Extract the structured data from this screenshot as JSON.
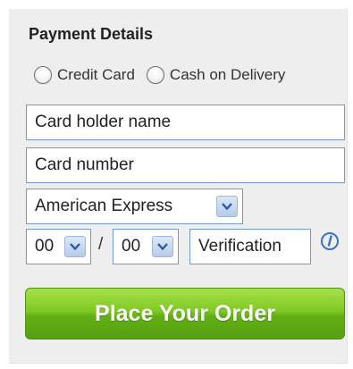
{
  "form": {
    "title": "Payment Details",
    "payment_options": [
      {
        "label": "Credit Card"
      },
      {
        "label": "Cash on Delivery"
      }
    ],
    "card_holder_name": {
      "value": "Card holder name"
    },
    "card_number": {
      "value": "Card number"
    },
    "card_type": {
      "selected": "American Express"
    },
    "expiry_month": {
      "selected": "00"
    },
    "expiry_separator": "/",
    "expiry_year": {
      "selected": "00"
    },
    "verification": {
      "value": "Verification"
    },
    "info_icon": "info-icon",
    "submit_label": "Place Your Order"
  },
  "colors": {
    "panel_bg": "#eeeeee",
    "field_border": "#6f9ac9",
    "button_green": "#7fc924",
    "info_blue": "#3b6fc9"
  }
}
